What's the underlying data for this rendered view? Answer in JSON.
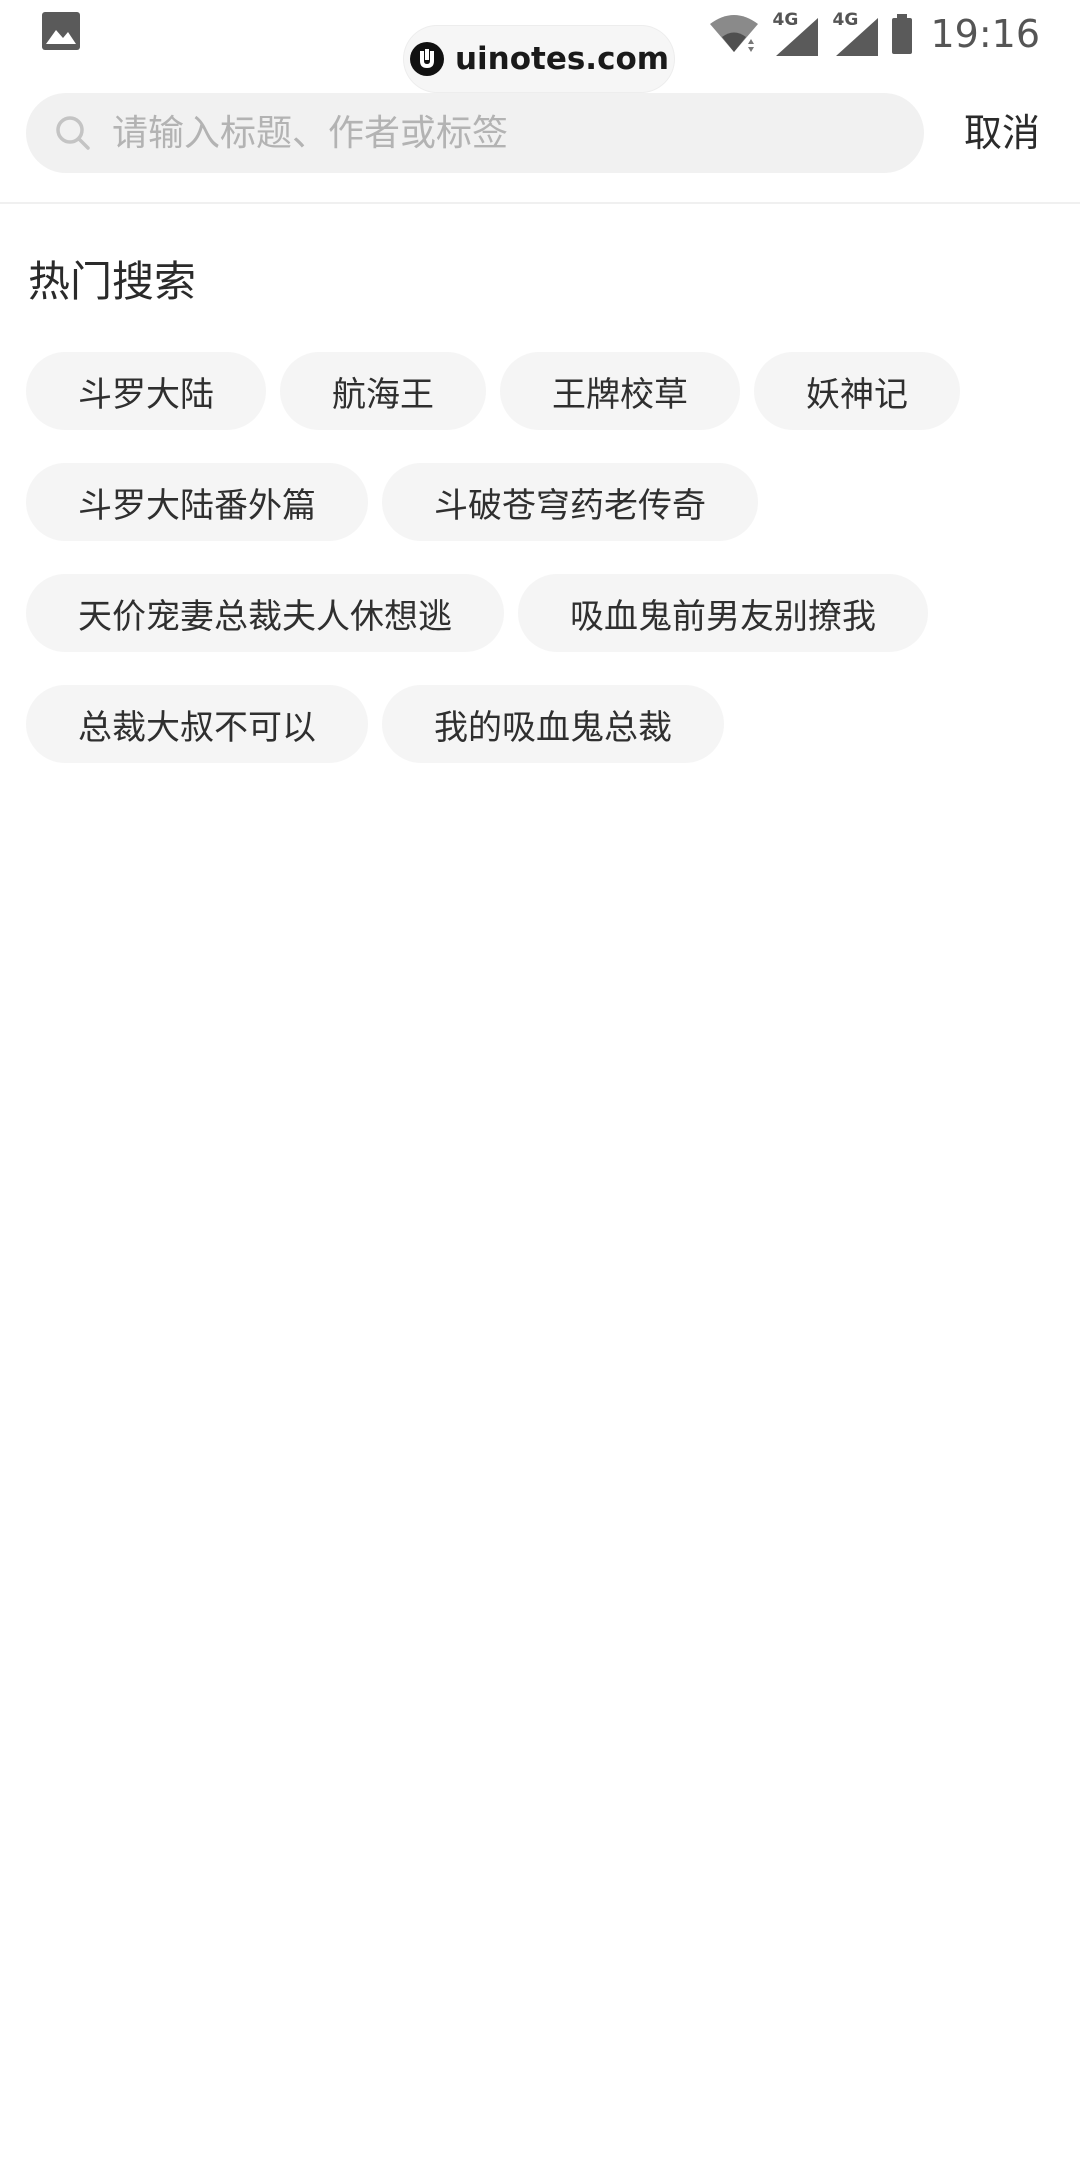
{
  "status_bar": {
    "network_1": "4G",
    "network_2": "4G",
    "time": "19:16"
  },
  "watermark": {
    "text": "uinotes.com"
  },
  "search": {
    "placeholder": "请输入标题、作者或标签",
    "value": "",
    "cancel_label": "取消"
  },
  "hot_search": {
    "title": "热门搜索",
    "rows": [
      [
        "斗罗大陆",
        "航海王",
        "王牌校草",
        "妖神记"
      ],
      [
        "斗罗大陆番外篇",
        "斗破苍穹药老传奇"
      ],
      [
        "天价宠妻总裁夫人休想逃",
        "吸血鬼前男友别撩我"
      ],
      [
        "总裁大叔不可以",
        "我的吸血鬼总裁"
      ]
    ]
  },
  "icons": {
    "gallery": "gallery-icon",
    "wifi": "wifi-icon",
    "signal": "signal-icon",
    "battery": "battery-icon",
    "search": "search-icon",
    "logo": "uinotes-logo-icon"
  },
  "colors": {
    "search_bg": "#f1f1f1",
    "tag_bg": "#f5f5f5",
    "placeholder": "#b3b3b3",
    "text": "#2a2a2a"
  }
}
